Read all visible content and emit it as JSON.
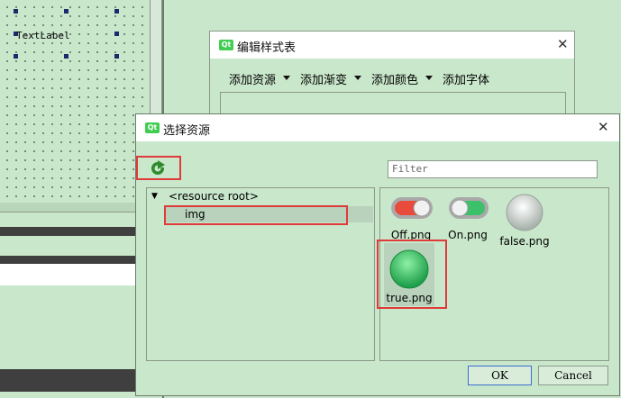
{
  "canvas": {
    "text_label": "TextLabel"
  },
  "stylesheet_dialog": {
    "title": "编辑样式表",
    "menu": [
      {
        "label": "添加资源"
      },
      {
        "label": "添加渐变"
      },
      {
        "label": "添加颜色"
      },
      {
        "label": "添加字体"
      }
    ]
  },
  "resource_dialog": {
    "title": "选择资源",
    "filter_placeholder": "Filter",
    "tree": {
      "root": "<resource root>",
      "child": "img"
    },
    "files": [
      {
        "name": "Off.png",
        "icon": "toggle-off-icon"
      },
      {
        "name": "On.png",
        "icon": "toggle-on-icon"
      },
      {
        "name": "false.png",
        "icon": "grey-ball-icon"
      },
      {
        "name": "true.png",
        "icon": "green-ball-icon"
      }
    ],
    "ok_label": "OK",
    "cancel_label": "Cancel"
  },
  "colors": {
    "highlight": "#e03a3a",
    "background": "#c9e7cb",
    "accent": "#41cd52"
  }
}
